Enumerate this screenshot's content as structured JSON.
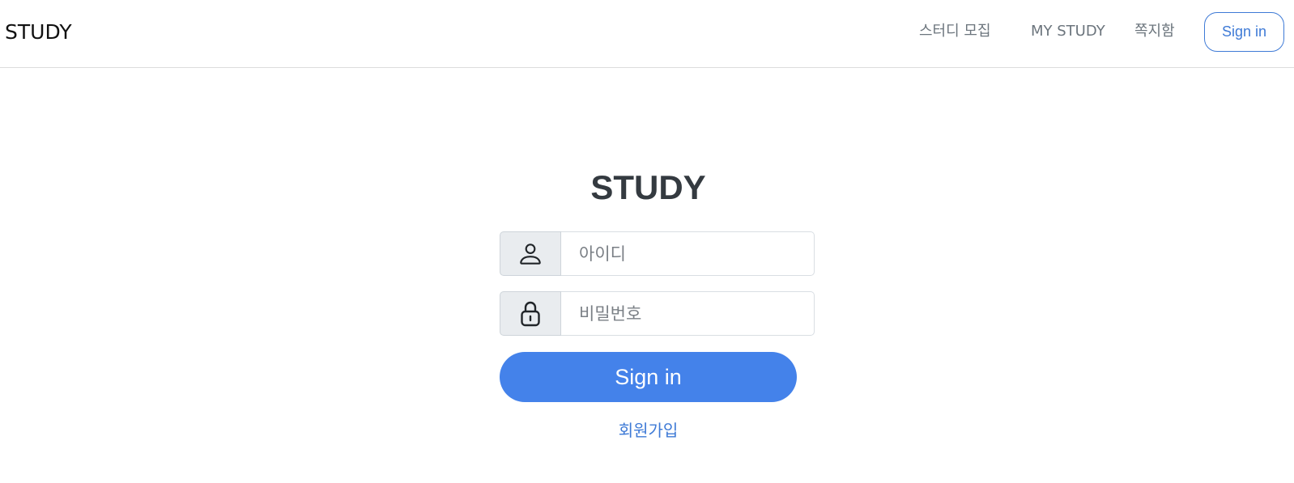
{
  "navbar": {
    "brand": "STUDY",
    "links": {
      "recruit": "스터디 모집",
      "my_study": "MY STUDY",
      "messages": "쪽지함"
    },
    "signin_label": "Sign in"
  },
  "login": {
    "title": "STUDY",
    "id_field": {
      "placeholder": "아이디",
      "value": "",
      "icon": "person-icon"
    },
    "password_field": {
      "placeholder": "비밀번호",
      "value": "",
      "icon": "lock-icon"
    },
    "submit_label": "Sign in",
    "signup_label": "회원가입"
  },
  "colors": {
    "accent": "#4482ea",
    "link": "#3e7ad6",
    "title": "#343a40",
    "nav_text": "#6c757d",
    "addon_bg": "#e9ecef"
  }
}
